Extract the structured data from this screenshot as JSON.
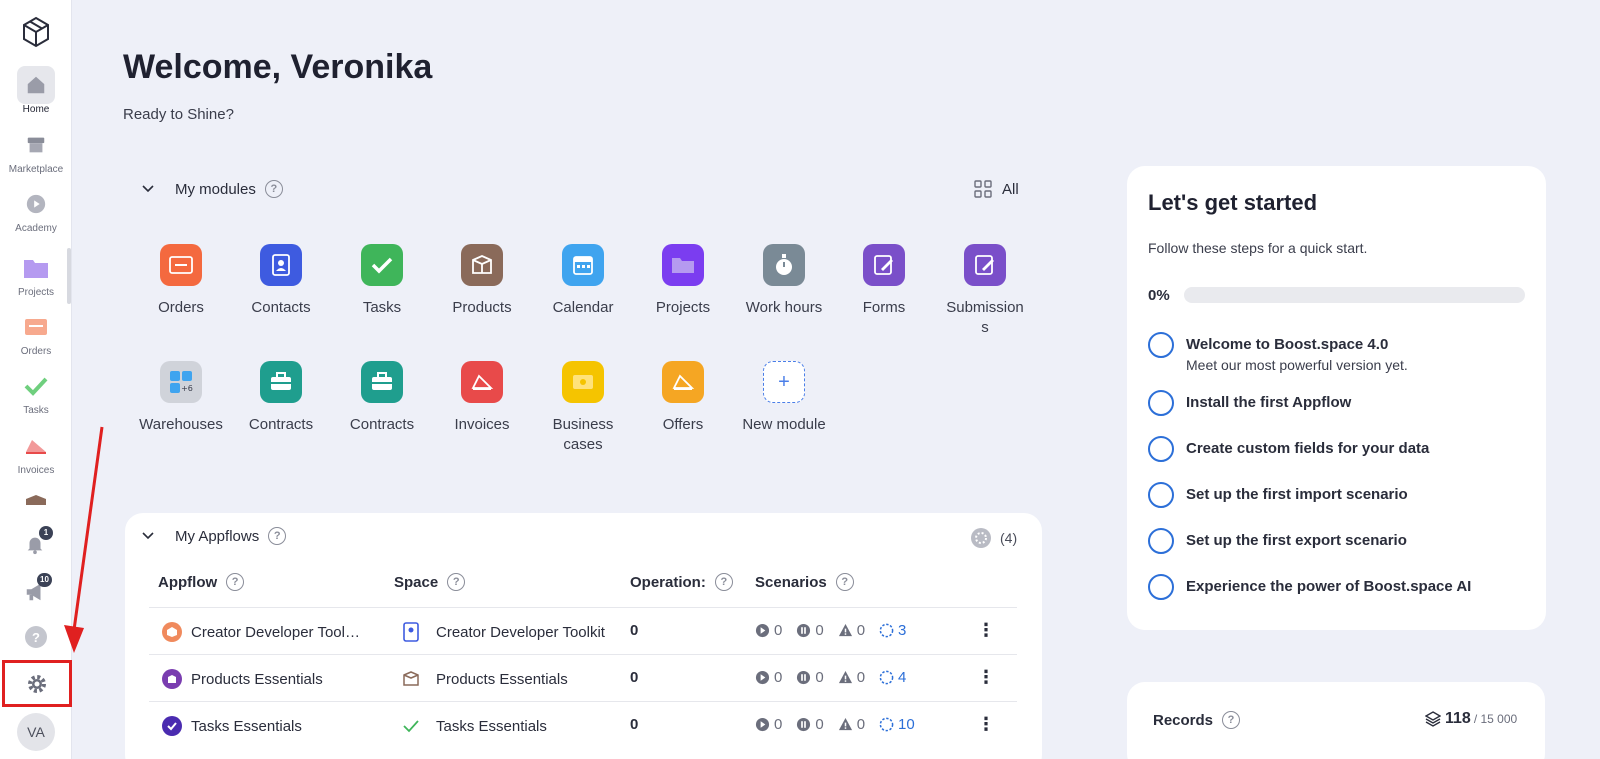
{
  "sidebar": {
    "items": [
      {
        "label": "Home",
        "icon": "home-icon",
        "active": true
      },
      {
        "label": "Marketplace",
        "icon": "store-icon"
      },
      {
        "label": "Academy",
        "icon": "play-icon"
      },
      {
        "label": "Projects",
        "icon": "folder-icon"
      },
      {
        "label": "Orders",
        "icon": "orders-icon"
      },
      {
        "label": "Tasks",
        "icon": "check-icon"
      },
      {
        "label": "Invoices",
        "icon": "invoice-icon"
      }
    ],
    "notifications_count": "1",
    "announcements_count": "10",
    "avatar_initials": "VA"
  },
  "header": {
    "title": "Welcome, Veronika",
    "subtitle": "Ready to Shine?"
  },
  "modules": {
    "section_title": "My modules",
    "all_label": "All",
    "items": [
      {
        "label": "Orders",
        "color": "#f4693f"
      },
      {
        "label": "Contacts",
        "color": "#3e5be0"
      },
      {
        "label": "Tasks",
        "color": "#3fb55a"
      },
      {
        "label": "Products",
        "color": "#8a6a5a"
      },
      {
        "label": "Calendar",
        "color": "#3fa4ef"
      },
      {
        "label": "Projects",
        "color": "#7b3df0"
      },
      {
        "label": "Work hours",
        "color": "#7a8a96"
      },
      {
        "label": "Forms",
        "color": "#7a4fc9"
      },
      {
        "label": "Submission\ns",
        "color": "#7a4fc9"
      },
      {
        "label": "Warehouses",
        "color": "#d0d3da"
      },
      {
        "label": "Contracts",
        "color": "#1f9e8e"
      },
      {
        "label": "Contracts",
        "color": "#1f9e8e"
      },
      {
        "label": "Invoices",
        "color": "#e84a4a"
      },
      {
        "label": "Business cases",
        "color": "#f5c400"
      },
      {
        "label": "Offers",
        "color": "#f5a623"
      },
      {
        "label": "New module",
        "color": "#4a7ee8"
      }
    ]
  },
  "appflows": {
    "section_title": "My Appflows",
    "count": "(4)",
    "columns": [
      "Appflow",
      "Space",
      "Operation:",
      "Scenarios"
    ],
    "rows": [
      {
        "name": "Creator Developer Tool…",
        "space": "Creator Developer Toolkit",
        "operations": "0",
        "running": "0",
        "paused": "0",
        "warnings": "0",
        "total": "3"
      },
      {
        "name": "Products Essentials",
        "space": "Products Essentials",
        "operations": "0",
        "running": "0",
        "paused": "0",
        "warnings": "0",
        "total": "4"
      },
      {
        "name": "Tasks Essentials",
        "space": "Tasks Essentials",
        "operations": "0",
        "running": "0",
        "paused": "0",
        "warnings": "0",
        "total": "10"
      }
    ]
  },
  "get_started": {
    "title": "Let's get started",
    "subtitle": "Follow these steps for a quick start.",
    "progress_label": "0%",
    "progress": 0,
    "steps": [
      {
        "title": "Welcome to Boost.space 4.0",
        "desc": "Meet our most powerful version yet."
      },
      {
        "title": "Install the first Appflow"
      },
      {
        "title": "Create custom fields for your data"
      },
      {
        "title": "Set up the first import scenario"
      },
      {
        "title": "Set up the first export scenario"
      },
      {
        "title": "Experience the power of Boost.space AI"
      }
    ]
  },
  "records": {
    "title": "Records",
    "value": "118",
    "limit": "/ 15 000"
  },
  "colors": {
    "accent": "#2c6fd8",
    "highlight": "#e02020"
  }
}
